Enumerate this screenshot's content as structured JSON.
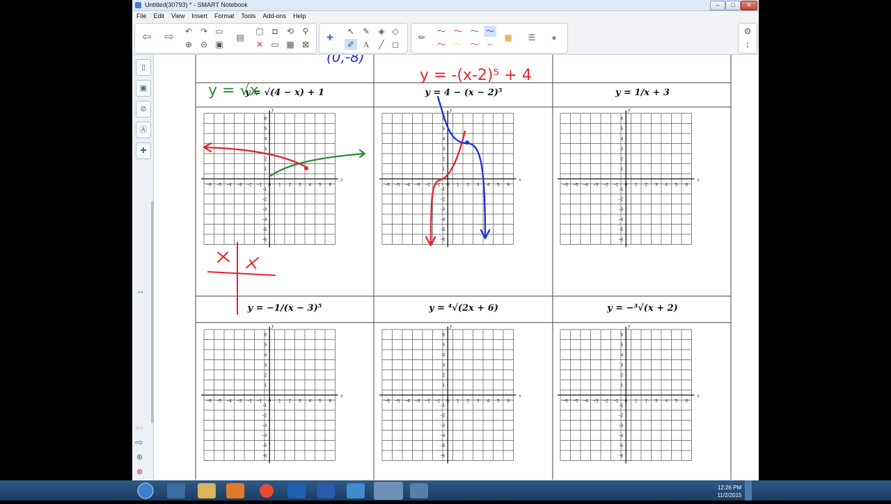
{
  "window": {
    "title": "Untitled(30793) * - SMART Notebook"
  },
  "menu": [
    "File",
    "Edit",
    "View",
    "Insert",
    "Format",
    "Tools",
    "Add-ons",
    "Help"
  ],
  "window_controls": {
    "minimize": "–",
    "maximize": "□",
    "close": "✕"
  },
  "toolbar": {
    "icons": [
      "back-icon",
      "forward-icon",
      "undo-icon",
      "redo-icon",
      "open-icon",
      "screen-icon",
      "paste-icon",
      "camera-icon",
      "rotate-icon",
      "magnifier-icon",
      "add-page-icon",
      "delete-icon",
      "screen-shade-icon",
      "table-icon",
      "close-icon",
      "puzzle-icon",
      "select-icon",
      "pen-icon",
      "eraser-icon",
      "text-icon",
      "line-icon",
      "shape-icon",
      "color-icon",
      "properties-icon"
    ],
    "right_buttons": [
      "⚙",
      "↕"
    ]
  },
  "side_tabs": [
    "page-sorter-icon",
    "gallery-icon",
    "attachments-icon",
    "properties-icon",
    "addons-icon"
  ],
  "side_misc": {
    "resize": "↔"
  },
  "cells": [
    {
      "eq_main": "y = √(4 − x) + 1",
      "hand_above": "y = √x"
    },
    {
      "eq_main": "y = 4 − (x − 2)⁵",
      "hand_above": "y = -(x-2)⁵ + 4"
    },
    {
      "eq_main": "y = 1/x + 3"
    },
    {
      "eq_main": "y = −1/(x − 3)⁵"
    },
    {
      "eq_main": "y = ⁴√(2x + 6)"
    },
    {
      "eq_main": "y = −³√(x + 2)"
    }
  ],
  "grid": {
    "x_ticks": [
      "−6",
      "−5",
      "−4",
      "−3",
      "−2",
      "−1",
      "0",
      "1",
      "2",
      "3",
      "4",
      "5",
      "6"
    ],
    "y_ticks": [
      "6",
      "5",
      "4",
      "3",
      "2",
      "1",
      "−1",
      "−2",
      "−3",
      "−4",
      "−5",
      "−6"
    ],
    "x_label": "x",
    "y_label": "y"
  },
  "annotations": {
    "top_fragment": "(0,-8)"
  },
  "colors": {
    "red": "#e0252c",
    "green": "#2c8a2c",
    "blue": "#1f34d8",
    "grid": "#555"
  },
  "taskbar": {
    "time": "12:26 PM",
    "date": "11/2/2015",
    "apps": [
      "start-orb-icon",
      "ie-icon",
      "explorer-icon",
      "media-icon",
      "chrome-icon",
      "outlook-icon",
      "word-icon",
      "notebook-icon",
      "smart-icon",
      "tool-icon"
    ]
  }
}
